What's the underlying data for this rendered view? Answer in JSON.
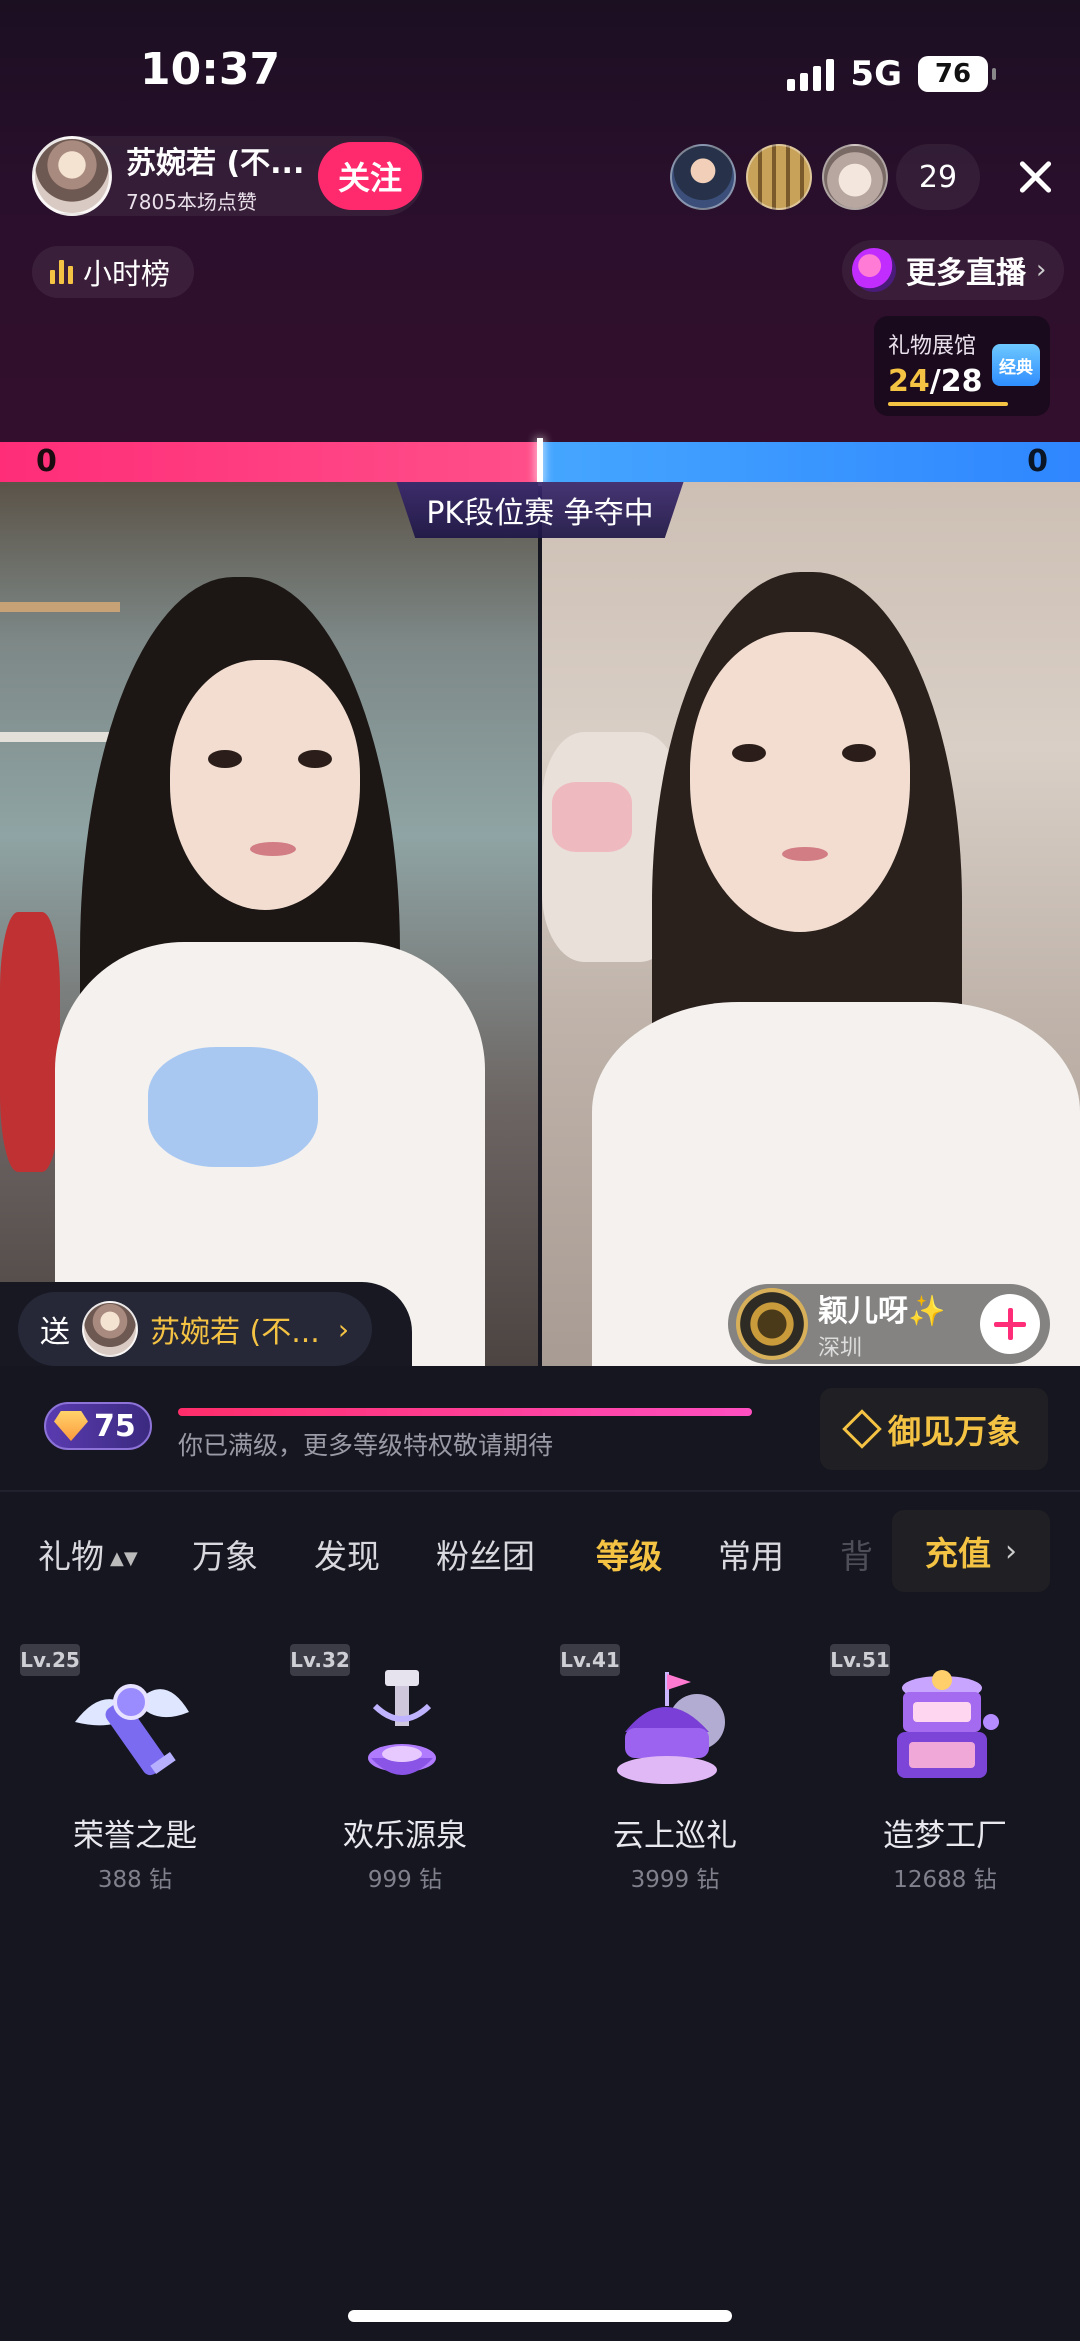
{
  "status_bar": {
    "time": "10:37",
    "network": "5G",
    "battery": "76"
  },
  "header": {
    "host_name": "苏婉若 (不...",
    "host_likes": "7805本场点赞",
    "follow_label": "关注",
    "viewer_count": "29"
  },
  "top_controls": {
    "hourly_rank_label": "小时榜",
    "more_live_label": "更多直播",
    "more_live_chevron": "›",
    "gift_hall": {
      "title": "礼物展馆",
      "current": "24",
      "total": "/28",
      "badge": "经典"
    }
  },
  "pk": {
    "score_left": "0",
    "score_right": "0",
    "title": "PK段位赛 争夺中"
  },
  "send_to": {
    "label": "送",
    "name": "苏婉若 (不...",
    "chevron": "›"
  },
  "opponent": {
    "name": "颖儿呀",
    "sparkle": "✨",
    "city": "深圳"
  },
  "level": {
    "value": "75",
    "progress": 1.0,
    "hint": "你已满级，更多等级特权敬请期待",
    "yujian_label": "御见万象"
  },
  "tabs": [
    {
      "label": "礼物",
      "sort": "▲▼"
    },
    {
      "label": "万象"
    },
    {
      "label": "发现"
    },
    {
      "label": "粉丝团"
    },
    {
      "label": "等级",
      "active": true
    },
    {
      "label": "常用"
    },
    {
      "label": "背"
    }
  ],
  "recharge": {
    "label": "充值",
    "chevron": "›"
  },
  "gifts": [
    {
      "level": "Lv.25",
      "name": "荣誉之匙",
      "price": "388 钻",
      "icon": "honor-key-icon"
    },
    {
      "level": "Lv.32",
      "name": "欢乐源泉",
      "price": "999 钻",
      "icon": "joy-fountain-icon"
    },
    {
      "level": "Lv.41",
      "name": "云上巡礼",
      "price": "3999 钻",
      "icon": "cloud-ship-icon"
    },
    {
      "level": "Lv.51",
      "name": "造梦工厂",
      "price": "12688 钻",
      "icon": "dream-factory-icon"
    }
  ],
  "colors": {
    "accent_gold": "#f5c343",
    "pk_red": "#ff2d78",
    "pk_blue": "#3b96ff",
    "follow_pink": "#ff2a6d"
  }
}
